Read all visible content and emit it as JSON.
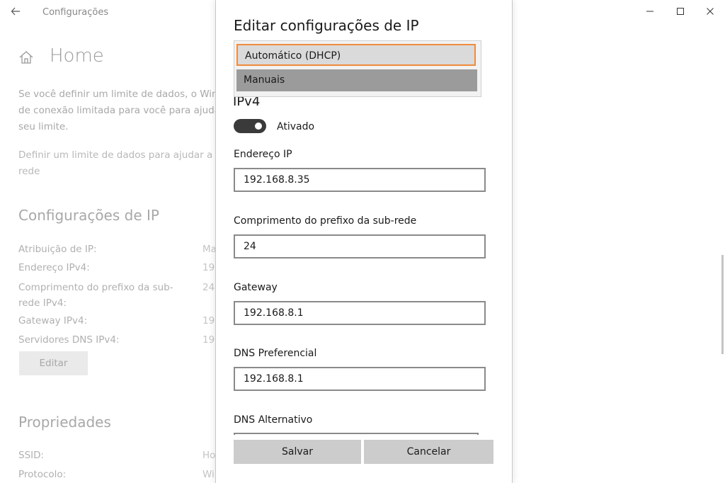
{
  "window": {
    "title": "Configurações",
    "back_icon": "arrow-left-icon"
  },
  "background": {
    "home_title": "Home",
    "info_line1": "Se você definir um limite de dados, o Win",
    "info_line2": "de conexão limitada para você para ajudá",
    "info_line3": "seu limite.",
    "link_line1": "Definir um limite de dados para ajudar a c",
    "link_line2": "rede",
    "ip_section_title": "Configurações de IP",
    "ip_rows": [
      {
        "label": "Atribuição de IP:",
        "value": "Ma"
      },
      {
        "label": "Endereço IPv4:",
        "value": "192"
      },
      {
        "label": "Comprimento do prefixo da sub-rede IPv4:",
        "value": "24"
      },
      {
        "label": "Gateway IPv4:",
        "value": "192"
      },
      {
        "label": "Servidores DNS IPv4:",
        "value": "192"
      }
    ],
    "edit_button": "Editar",
    "prop_section_title": "Propriedades",
    "prop_rows": [
      {
        "label": "SSID:",
        "value": "Ho"
      },
      {
        "label": "Protocolo:",
        "value": "Wi"
      }
    ]
  },
  "dialog": {
    "title": "Editar configurações de IP",
    "dropdown": {
      "options": [
        "Automático (DHCP)",
        "Manuais"
      ],
      "highlight_color": "#f08b3b"
    },
    "ipv4_heading": "IPv4",
    "toggle_label": "Ativado",
    "fields": [
      {
        "label": "Endereço IP",
        "value": "192.168.8.35"
      },
      {
        "label": "Comprimento do prefixo da sub-rede",
        "value": "24"
      },
      {
        "label": "Gateway",
        "value": "192.168.8.1"
      },
      {
        "label": "DNS Preferencial",
        "value": "192.168.8.1"
      },
      {
        "label": "DNS Alternativo",
        "value": ""
      }
    ],
    "save_button": "Salvar",
    "cancel_button": "Cancelar"
  }
}
